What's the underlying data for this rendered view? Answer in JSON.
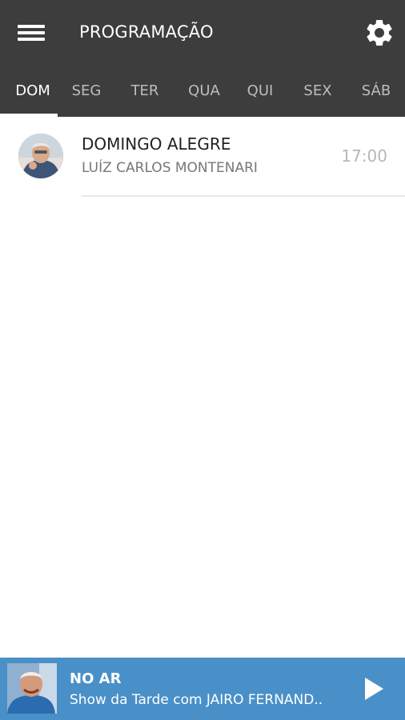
{
  "header": {
    "title": "PROGRAMAÇÃO",
    "menu_icon": "hamburger-menu-icon",
    "settings_icon": "gear-icon",
    "background": "#3d3d3d"
  },
  "tabs": {
    "active": "DOM",
    "items": [
      "DOM",
      "SEG",
      "TER",
      "QUA",
      "QUI",
      "SEX",
      "SÁB"
    ]
  },
  "schedule": [
    {
      "title": "DOMINGO ALEGRE",
      "host": "LUÍZ CARLOS MONTENARI",
      "time": "17:00"
    }
  ],
  "now_playing": {
    "label": "NO AR",
    "show": "Show da Tarde com JAIRO FERNAND..",
    "play_icon": "play-icon",
    "background": "#4a90c8"
  }
}
